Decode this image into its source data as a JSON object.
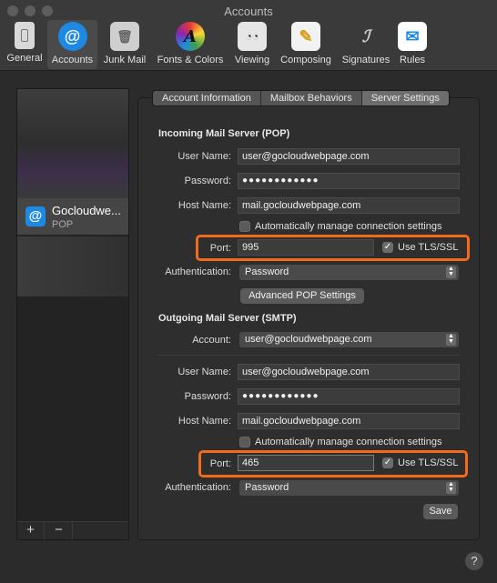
{
  "window": {
    "title": "Accounts"
  },
  "toolbar": {
    "items": [
      {
        "label": "General",
        "icon": "general-switch-icon"
      },
      {
        "label": "Accounts",
        "icon": "at-sign-icon"
      },
      {
        "label": "Junk Mail",
        "icon": "trash-bin-icon"
      },
      {
        "label": "Fonts & Colors",
        "icon": "color-wheel-icon"
      },
      {
        "label": "Viewing",
        "icon": "glasses-icon"
      },
      {
        "label": "Composing",
        "icon": "pencil-paper-icon"
      },
      {
        "label": "Signatures",
        "icon": "signature-icon"
      },
      {
        "label": "Rules",
        "icon": "envelope-arrows-icon"
      }
    ]
  },
  "accounts": {
    "selected": {
      "name": "Gocloudwe...",
      "type": "POP"
    },
    "add_label": "+",
    "remove_label": "−"
  },
  "tabs": [
    "Account Information",
    "Mailbox Behaviors",
    "Server Settings"
  ],
  "incoming": {
    "title": "Incoming Mail Server (POP)",
    "user_name_label": "User Name:",
    "user_name": "user@gocloudwebpage.com",
    "password_label": "Password:",
    "password": "●●●●●●●●●●●●",
    "host_label": "Host Name:",
    "host": "mail.gocloudwebpage.com",
    "auto_manage_label": "Automatically manage connection settings",
    "port_label": "Port:",
    "port": "995",
    "tls_label": "Use TLS/SSL",
    "auth_label": "Authentication:",
    "auth": "Password",
    "advanced_button": "Advanced POP Settings"
  },
  "outgoing": {
    "title": "Outgoing Mail Server (SMTP)",
    "account_label": "Account:",
    "account": "user@gocloudwebpage.com",
    "user_name_label": "User Name:",
    "user_name": "user@gocloudwebpage.com",
    "password_label": "Password:",
    "password": "●●●●●●●●●●●●",
    "host_label": "Host Name:",
    "host": "mail.gocloudwebpage.com",
    "auto_manage_label": "Automatically manage connection settings",
    "port_label": "Port:",
    "port": "465",
    "tls_label": "Use TLS/SSL",
    "auth_label": "Authentication:",
    "auth": "Password"
  },
  "save_button": "Save",
  "help_label": "?",
  "colors": {
    "highlight": "#f26b1d",
    "accent": "#1e88e5"
  }
}
